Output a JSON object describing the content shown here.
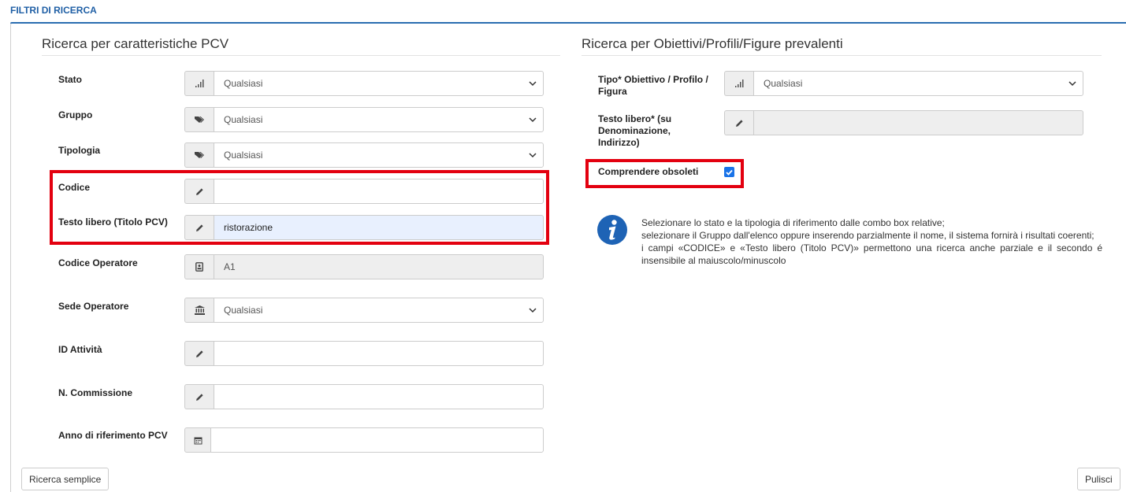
{
  "header": {
    "title": "FILTRI DI RICERCA"
  },
  "left_section": {
    "title": "Ricerca per caratteristiche PCV",
    "fields": {
      "stato": {
        "label": "Stato",
        "value": "Qualsiasi"
      },
      "gruppo": {
        "label": "Gruppo",
        "value": "Qualsiasi"
      },
      "tipologia": {
        "label": "Tipologia",
        "value": "Qualsiasi"
      },
      "codice": {
        "label": "Codice",
        "value": ""
      },
      "testo_libero": {
        "label": "Testo libero (Titolo PCV)",
        "value": "ristorazione"
      },
      "codice_operatore": {
        "label": "Codice Operatore",
        "value": "A1"
      },
      "sede_operatore": {
        "label": "Sede Operatore",
        "value": "Qualsiasi"
      },
      "id_attivita": {
        "label": "ID Attività",
        "value": ""
      },
      "n_commissione": {
        "label": "N. Commissione",
        "value": ""
      },
      "anno": {
        "label": "Anno di riferimento PCV",
        "value": ""
      }
    }
  },
  "right_section": {
    "title": "Ricerca per Obiettivi/Profili/Figure prevalenti",
    "fields": {
      "tipo": {
        "label": "Tipo* Obiettivo / Profilo / Figura",
        "value": "Qualsiasi"
      },
      "testo_libero": {
        "label": "Testo libero* (su Denominazione, Indirizzo)",
        "value": ""
      },
      "obsoleti": {
        "label": "Comprendere obsoleti",
        "checked": true
      }
    },
    "info": {
      "line1": "Selezionare lo stato e la tipologia di riferimento dalle combo box relative;",
      "line2": "selezionare il Gruppo dall'elenco oppure inserendo parzialmente il nome, il sistema fornirà i risultati coerenti;",
      "line3": "i campi «CODICE» e «Testo libero (Titolo PCV)» permettono una ricerca anche parziale e il secondo é insensibile al maiuscolo/minuscolo"
    }
  },
  "buttons": {
    "ricerca_semplice": "Ricerca semplice",
    "pulisci": "Pulisci"
  },
  "colors": {
    "accent": "#1f5fa5",
    "highlight": "#e3000f",
    "checkbox": "#1a73e8"
  }
}
